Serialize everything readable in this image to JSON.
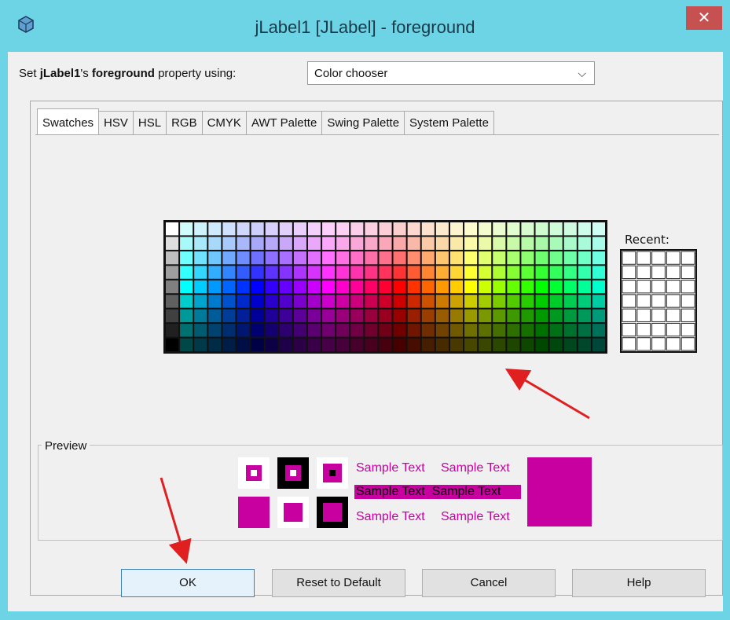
{
  "window": {
    "title": "jLabel1 [JLabel] - foreground",
    "close_label": "✕",
    "accent": "#6dd4e5"
  },
  "property": {
    "prefix": "Set ",
    "component": "jLabel1",
    "mid": "'s ",
    "property_name": "foreground",
    "suffix": " property using:",
    "selected_editor": "Color chooser"
  },
  "tabs": [
    {
      "label": "Swatches",
      "active": true
    },
    {
      "label": "HSV"
    },
    {
      "label": "HSL"
    },
    {
      "label": "RGB"
    },
    {
      "label": "CMYK"
    },
    {
      "label": "AWT Palette"
    },
    {
      "label": "Swing Palette"
    },
    {
      "label": "System Palette"
    }
  ],
  "recent_label": "Recent:",
  "preview": {
    "title": "Preview",
    "sample_text": "Sample Text",
    "color": "#c800a0"
  },
  "buttons": {
    "ok": "OK",
    "reset": "Reset to Default",
    "cancel": "Cancel",
    "help": "Help"
  }
}
